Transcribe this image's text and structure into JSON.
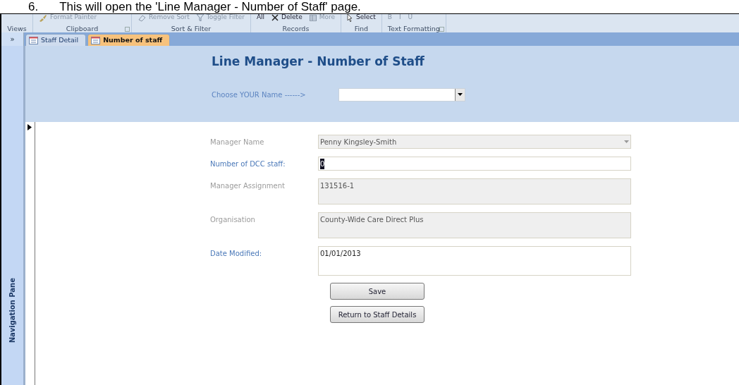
{
  "caption": {
    "number": "6.",
    "text": "This will open the 'Line Manager - Number of Staff' page."
  },
  "ribbon": {
    "groups": [
      {
        "label": "Views"
      },
      {
        "label": "Clipboard",
        "items": [
          {
            "kind": "brush",
            "label": "Format Painter"
          }
        ],
        "launcher": true
      },
      {
        "label": "Sort & Filter",
        "items": [
          {
            "kind": "eraser",
            "label": "Remove Sort"
          },
          {
            "kind": "funnel",
            "label": "Toggle Filter"
          }
        ]
      },
      {
        "label": "Records",
        "items": [
          {
            "kind": "dropdown",
            "label": "All"
          },
          {
            "kind": "cross",
            "label": "Delete"
          },
          {
            "kind": "grid",
            "label": "More"
          }
        ]
      },
      {
        "label": "Find",
        "items": [
          {
            "kind": "cursor",
            "label": "Select"
          }
        ]
      },
      {
        "label": "Text Formatting",
        "items": [
          {
            "kind": "letter",
            "label": "B"
          },
          {
            "kind": "letter",
            "label": "I"
          },
          {
            "kind": "letter",
            "label": "U"
          }
        ],
        "launcher": true
      }
    ]
  },
  "nav_pane": {
    "label": "Navigation Pane",
    "expand": "»"
  },
  "tabs": [
    {
      "label": "Staff Detail",
      "selected": false
    },
    {
      "label": "Number of staff",
      "selected": true
    }
  ],
  "form": {
    "title": "Line Manager - Number of Staff",
    "chooser": {
      "label": "Choose YOUR Name ------>"
    },
    "fields": [
      {
        "label": "Manager Name",
        "kind": "combo",
        "locked": true,
        "value": "Penny Kingsley-Smith"
      },
      {
        "label": "Number of DCC staff:",
        "kind": "text",
        "locked": false,
        "value": "0",
        "selected_text": true
      },
      {
        "label": "Manager Assignment",
        "kind": "memo",
        "locked": true,
        "value": "131516-1"
      },
      {
        "label": "Organisation",
        "kind": "memo",
        "locked": true,
        "value": "County-Wide Care Direct Plus"
      },
      {
        "label": "Date Modified:",
        "kind": "memo",
        "locked": false,
        "value": "01/01/2013"
      }
    ],
    "buttons": [
      "Save",
      "Return to Staff Details"
    ]
  }
}
